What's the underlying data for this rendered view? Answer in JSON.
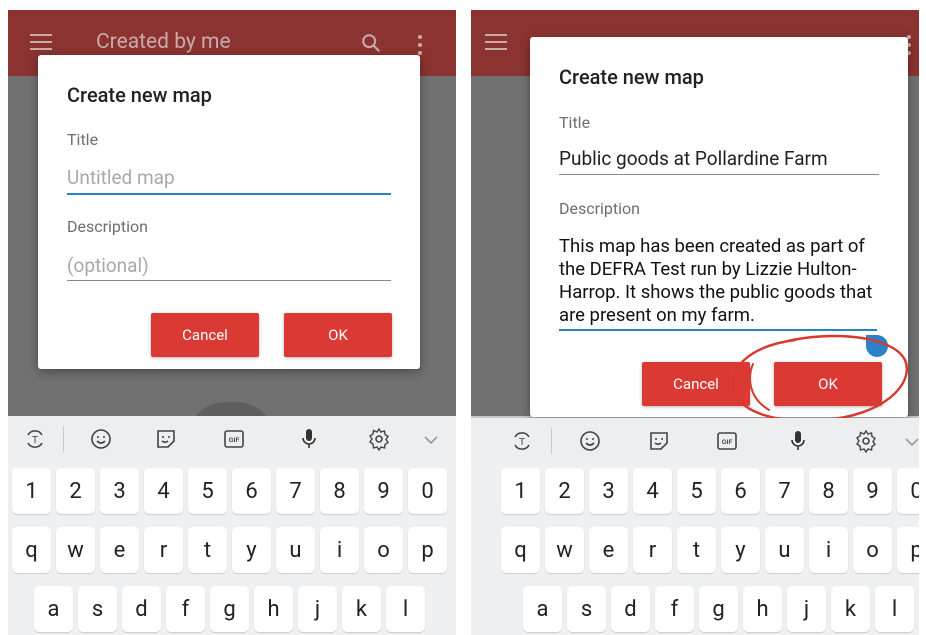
{
  "left_screen": {
    "appbar": {
      "title": "Created by me"
    },
    "dialog": {
      "title": "Create new map",
      "title_label": "Title",
      "title_placeholder": "Untitled map",
      "description_label": "Description",
      "description_placeholder": "(optional)",
      "cancel_label": "Cancel",
      "ok_label": "OK"
    }
  },
  "right_screen": {
    "dialog": {
      "title": "Create new map",
      "title_label": "Title",
      "title_value": "Public goods at Pollardine Farm",
      "description_label": "Description",
      "description_value": "This map has been created as part of the DEFRA Test run by Lizzie Hulton-Harrop. It shows the public goods that are present on my farm.",
      "cancel_label": "Cancel",
      "ok_label": "OK"
    },
    "annotation": {
      "color": "#d7382f",
      "shape": "hand-drawn-circle-around-ok"
    }
  },
  "keyboard": {
    "toolbar_icons": [
      "text-translate-icon",
      "emoji-icon",
      "sticker-icon",
      "gif-icon",
      "microphone-icon",
      "settings-icon",
      "chevron-down-icon"
    ],
    "gif_label": "GIF",
    "rows": [
      [
        "1",
        "2",
        "3",
        "4",
        "5",
        "6",
        "7",
        "8",
        "9",
        "0"
      ],
      [
        "q",
        "w",
        "e",
        "r",
        "t",
        "y",
        "u",
        "i",
        "o",
        "p"
      ],
      [
        "a",
        "s",
        "d",
        "f",
        "g",
        "h",
        "j",
        "k",
        "l"
      ]
    ]
  },
  "colors": {
    "appbar": "#8a3330",
    "button": "#db3a34",
    "focus_line": "#2a82c9",
    "keyboard_bg": "#eff0f2"
  }
}
